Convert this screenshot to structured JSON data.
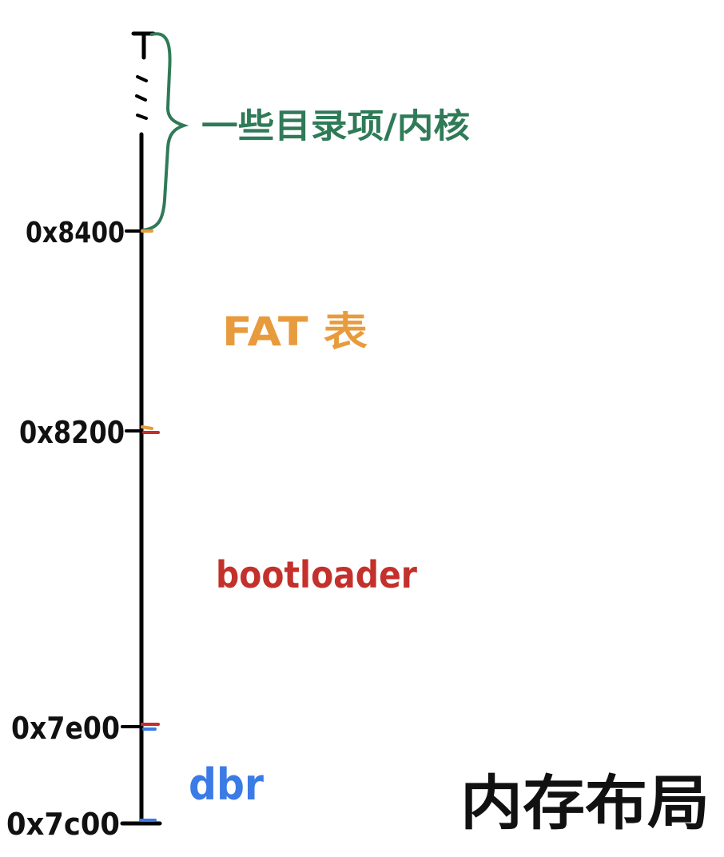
{
  "diagram": {
    "title": "内存布局",
    "addresses": [
      {
        "label": "0x8400"
      },
      {
        "label": "0x8200"
      },
      {
        "label": "0x7e00"
      },
      {
        "label": "0x7c00"
      }
    ],
    "regions": [
      {
        "label": "一些目录项/内核"
      },
      {
        "label": "FAT 表"
      },
      {
        "label": "bootloader"
      },
      {
        "label": "dbr"
      }
    ],
    "colors": {
      "axis": "#000000",
      "top_region": "#2f7a57",
      "fat": "#e89b3c",
      "bootloader": "#c4302b",
      "dbr": "#3a7be6",
      "address_text": "#111111"
    }
  }
}
